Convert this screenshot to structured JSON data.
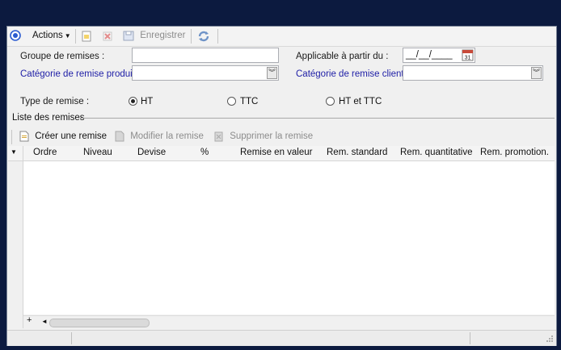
{
  "toolbar": {
    "actions_label": "Actions",
    "save_label": "Enregistrer"
  },
  "form": {
    "groupe_label": "Groupe de remises :",
    "categorie_produit_label": "Catégorie de remise produit :",
    "applicable_label": "Applicable à partir du :",
    "applicable_value": "__/__/____",
    "categorie_client_label": "Catégorie de remise client :",
    "type_label": "Type de remise :",
    "type_options": [
      "HT",
      "TTC",
      "HT et TTC"
    ],
    "type_selected": "HT"
  },
  "list": {
    "section_title": "Liste des remises",
    "create_label": "Créer une remise",
    "modify_label": "Modifier la remise",
    "delete_label": "Supprimer la remise",
    "columns": [
      "Ordre",
      "Niveau",
      "Devise",
      "%",
      "Remise en valeur",
      "Rem. standard",
      "Rem. quantitative",
      "Rem. promotion."
    ],
    "rows": []
  },
  "colors": {
    "background": "#0c1a3f",
    "label_blue": "#1d1da6"
  },
  "icons": [
    "radio-circle-icon",
    "chevron-down-icon",
    "new-doc-icon",
    "delete-x-icon",
    "save-icon",
    "refresh-icon",
    "calendar-icon",
    "document-icon",
    "edit-icon",
    "trash-icon",
    "plus-icon",
    "resize-grip-icon"
  ]
}
